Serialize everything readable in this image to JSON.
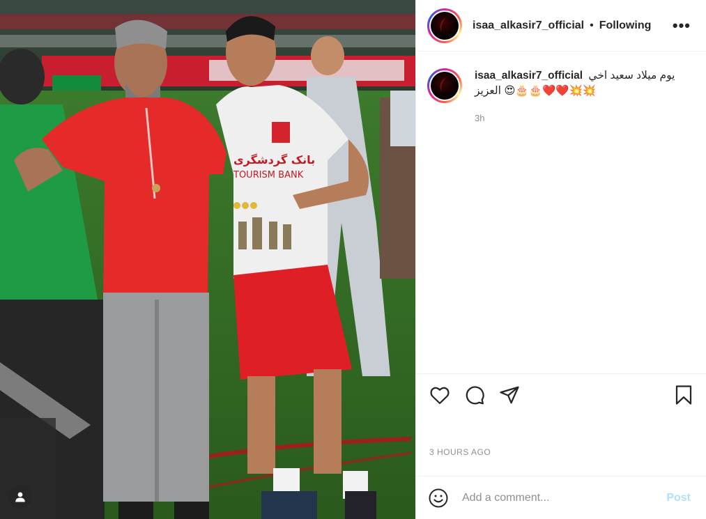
{
  "post": {
    "photo_alt": "Two men on a football pitch after a match",
    "author": {
      "username": "isaa_alkasir7_official",
      "follow_state": "Following",
      "separator": "•",
      "more_glyph": "•••"
    },
    "caption": {
      "username": "isaa_alkasir7_official",
      "text": "يوم ميلاد سعيد اخي العزيز",
      "emojis": "😍🎂🎂❤️❤️💥💥",
      "relative_time": "3h"
    },
    "actions": {
      "like_icon": "heart-icon",
      "comment_icon": "comment-bubble-icon",
      "share_icon": "paper-plane-icon",
      "save_icon": "bookmark-icon"
    },
    "timestamp": "3 HOURS AGO",
    "comment_box": {
      "placeholder": "Add a comment...",
      "post_label": "Post",
      "emoji_icon": "smiley-icon",
      "post_color": "#b2dffc"
    },
    "tag_icon": "user-tag-icon"
  },
  "colors": {
    "text": "#262626",
    "secondary": "#8e8e8e",
    "divider": "#efefef"
  }
}
